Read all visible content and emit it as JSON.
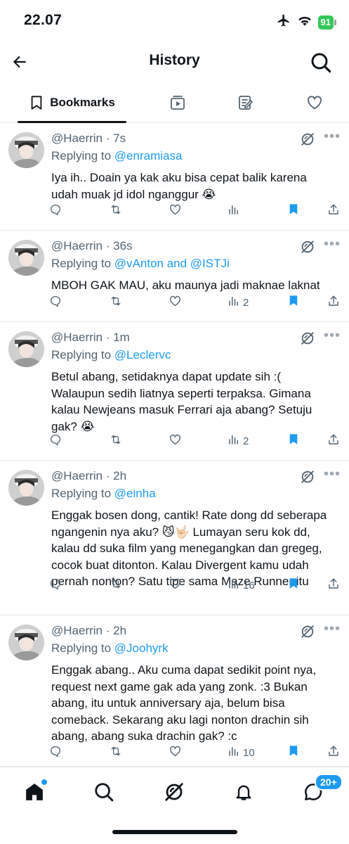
{
  "status": {
    "time": "22.07",
    "battery": "91"
  },
  "header": {
    "title": "History"
  },
  "tabs": [
    {
      "label": "Bookmarks",
      "icon": "bookmark-icon",
      "active": true
    },
    {
      "label": "",
      "icon": "video-icon"
    },
    {
      "label": "",
      "icon": "article-icon"
    },
    {
      "label": "",
      "icon": "heart-icon"
    }
  ],
  "colors": {
    "accent": "#1d9bf0",
    "text": "#0f1419",
    "muted": "#536471"
  },
  "tweets": [
    {
      "user": "@Haerrin",
      "time": "7s",
      "reply_prefix": "Replying to",
      "reply_to": "@enramiasa",
      "text": "Iya ih.. Doain ya kak aku bisa cepat balik karena udah muak jd idol nganggur 😭",
      "views": ""
    },
    {
      "user": "@Haerrin",
      "time": "36s",
      "reply_prefix": "Replying to",
      "reply_to": "@vAnton and @ISTJi",
      "text": "MBOH GAK MAU, aku maunya jadi maknae laknat",
      "views": "2"
    },
    {
      "user": "@Haerrin",
      "time": "1m",
      "reply_prefix": "Replying to",
      "reply_to": "@Leclervc",
      "text": "Betul abang, setidaknya dapat update sih :( Walaupun sedih liatnya seperti terpaksa. Gimana kalau Newjeans masuk Ferrari aja abang? Setuju gak? 😭",
      "views": "2"
    },
    {
      "user": "@Haerrin",
      "time": "2h",
      "reply_prefix": "Replying to",
      "reply_to": "@einha",
      "text": "Enggak bosen dong, cantik! Rate dong dd seberapa ngangenin nya aku? 😼🤟🏻 Lumayan seru kok dd, kalau dd suka film yang menegangkan dan gregeg, cocok buat ditonton. Kalau Divergent kamu udah pernah nonton? Satu tipe sama Maze Runner itu",
      "views": "16"
    },
    {
      "user": "@Haerrin",
      "time": "2h",
      "reply_prefix": "Replying to",
      "reply_to": "@Joohyrk",
      "text": "Enggak abang.. Aku cuma dapat sedikit point nya, request next game gak ada yang zonk. :3 Bukan abang, itu untuk anniversary aja, belum bisa comeback. Sekarang aku lagi nonton drachin sih abang, abang suka drachin gak? :c",
      "views": "10"
    }
  ],
  "bottom_nav": {
    "items": [
      "home-icon",
      "search-icon",
      "grok-icon",
      "bell-icon",
      "messages-icon"
    ],
    "messages_badge": "20+"
  }
}
